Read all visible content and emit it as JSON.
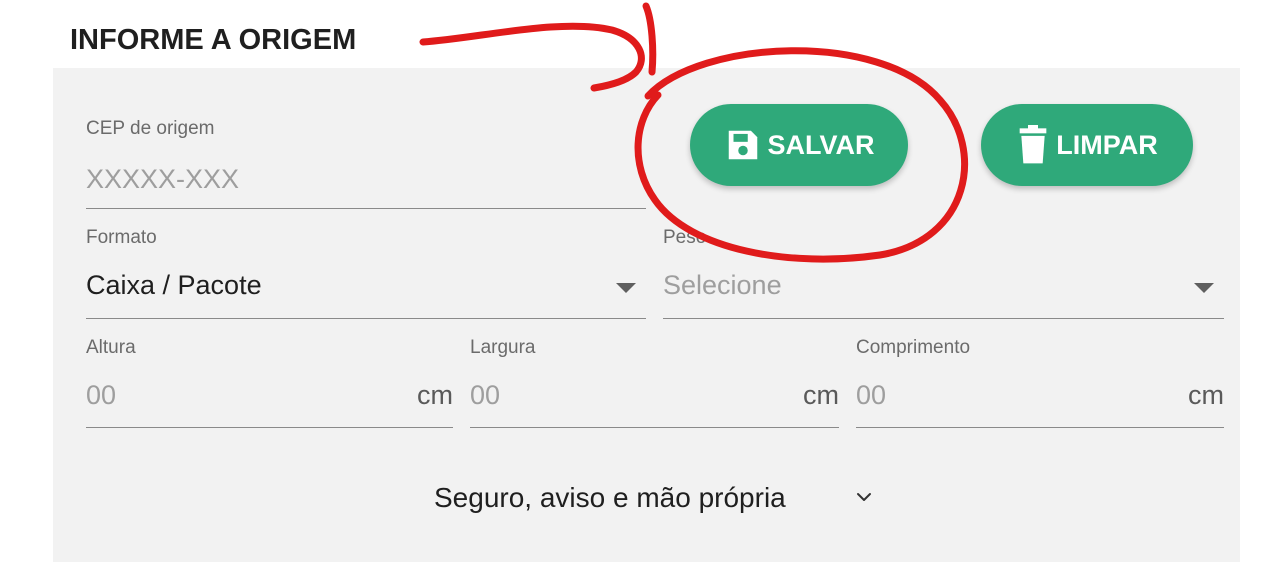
{
  "section": {
    "title": "INFORME A ORIGEM"
  },
  "cep": {
    "label": "CEP de origem",
    "placeholder": "XXXXX-XXX"
  },
  "buttons": {
    "save_label": "SALVAR",
    "clear_label": "LIMPAR"
  },
  "formato": {
    "label": "Formato",
    "value": "Caixa / Pacote"
  },
  "peso": {
    "label": "Peso",
    "placeholder": "Selecione"
  },
  "dimensions": {
    "altura": {
      "label": "Altura",
      "placeholder": "00",
      "unit": "cm"
    },
    "largura": {
      "label": "Largura",
      "placeholder": "00",
      "unit": "cm"
    },
    "comprimento": {
      "label": "Comprimento",
      "placeholder": "00",
      "unit": "cm"
    }
  },
  "accordion": {
    "label": "Seguro, aviso e mão própria"
  },
  "colors": {
    "button_green": "#2fa97a",
    "panel_bg": "#f2f2f2",
    "annotation_red": "#e01b1b"
  },
  "icons": {
    "save": "floppy-disk-icon",
    "clear": "trash-icon",
    "dropdown": "caret-down-icon",
    "accordion": "chevron-down-icon"
  }
}
